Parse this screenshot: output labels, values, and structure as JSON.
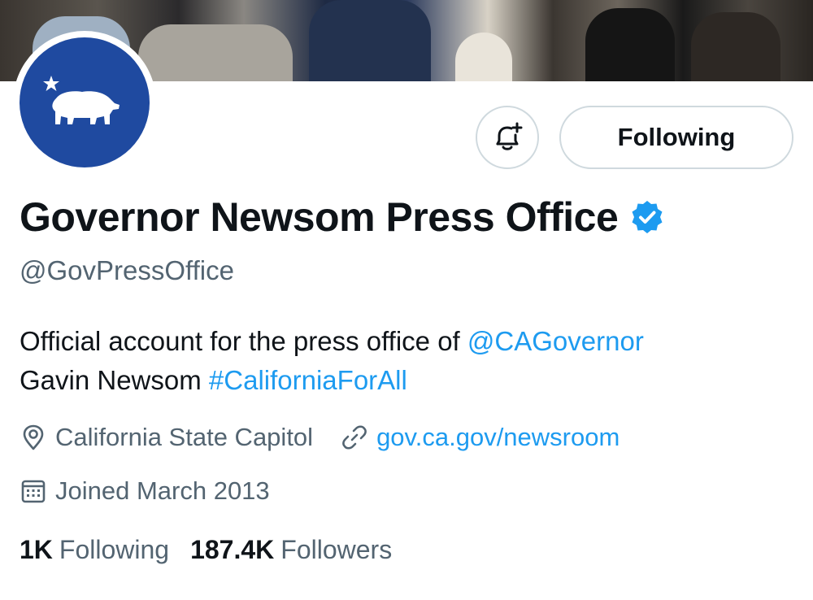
{
  "profile": {
    "display_name": "Governor Newsom Press Office",
    "handle": "@GovPressOffice",
    "verified": true,
    "bio": {
      "text_1": "Official account for the press office of ",
      "mention": "@CAGovernor",
      "text_2": "Gavin Newsom ",
      "hashtag": "#CaliforniaForAll"
    },
    "location": "California State Capitol",
    "website": "gov.ca.gov/newsroom",
    "joined": "Joined March 2013",
    "stats": {
      "following_count": "1K",
      "following_label": "Following",
      "followers_count": "187.4K",
      "followers_label": "Followers"
    }
  },
  "actions": {
    "follow_label": "Following"
  },
  "icons": {
    "notify": "bell-plus-icon",
    "verified": "verified-badge-icon",
    "location": "location-pin-icon",
    "link": "link-icon",
    "calendar": "calendar-icon",
    "avatar": "california-bear-star-logo"
  },
  "colors": {
    "accent": "#1d9bf0",
    "avatar_bg": "#1f4aa0",
    "text_primary": "#0f1419",
    "text_secondary": "#536471",
    "border": "#cfd9de"
  }
}
